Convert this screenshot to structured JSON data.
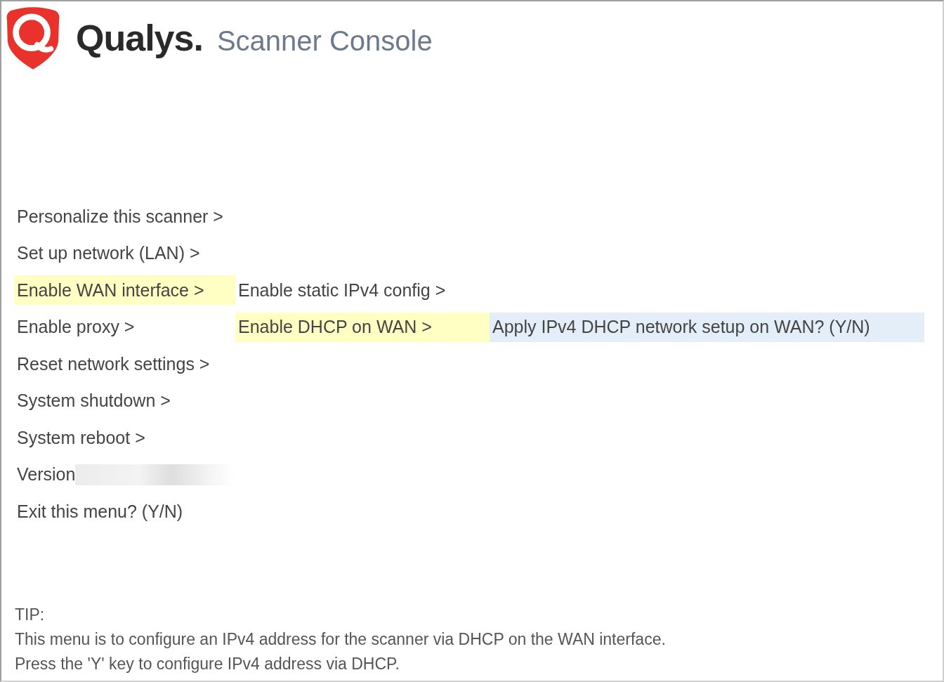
{
  "header": {
    "brand": "Qualys.",
    "title": "Scanner Console"
  },
  "menu": [
    {
      "label": "Personalize this scanner >",
      "selected": false
    },
    {
      "label": "Set up network (LAN) >",
      "selected": false
    },
    {
      "label": "Enable WAN interface >",
      "selected": true,
      "children": [
        {
          "label": "Enable static IPv4 config >",
          "selected": false
        },
        {
          "label": "Enable DHCP on WAN >",
          "selected": true,
          "children": [
            {
              "label": "Apply IPv4 DHCP network setup on WAN? (Y/N)",
              "selected": false,
              "focused": true
            }
          ]
        }
      ]
    },
    {
      "label": "Enable proxy >",
      "selected": false
    },
    {
      "label": "Reset network settings >",
      "selected": false
    },
    {
      "label": "System shutdown >",
      "selected": false
    },
    {
      "label": "System reboot >",
      "selected": false
    },
    {
      "label": "Version",
      "selected": false,
      "redacted": true
    },
    {
      "label": "Exit this menu? (Y/N)",
      "selected": false
    }
  ],
  "tip": {
    "heading": "TIP:",
    "lines": [
      "This menu is to configure an IPv4 address for the scanner via DHCP on the WAN interface.",
      "Press the 'Y' key to configure IPv4 address via DHCP."
    ]
  }
}
